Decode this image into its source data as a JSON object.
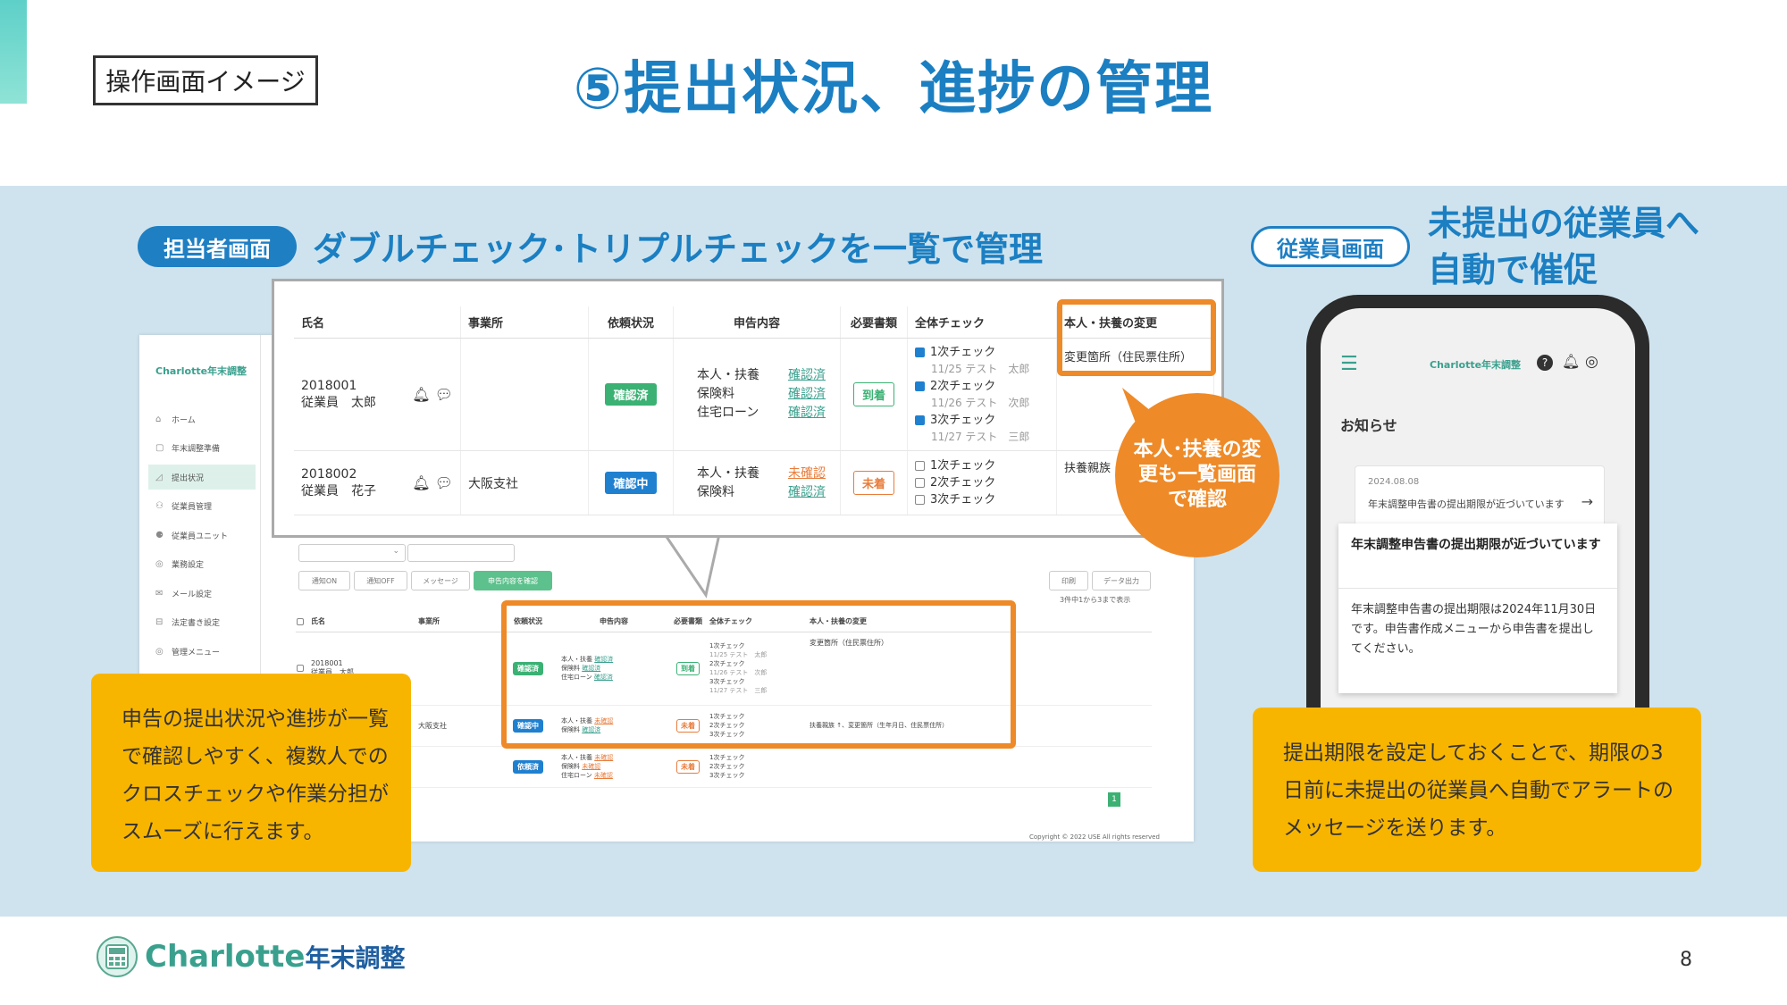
{
  "slide": {
    "op_label": "操作画面イメージ",
    "title": "⑤提出状況、進捗の管理",
    "page_number": "8"
  },
  "staff_section": {
    "pill": "担当者画面",
    "heading": "ダブルチェック･トリプルチェックを一覧で管理"
  },
  "employee_section": {
    "pill": "従業員画面",
    "heading_line1": "未提出の従業員へ",
    "heading_line2": "自動で催促"
  },
  "admin_app": {
    "logo": "Charlotte年末調整",
    "sidebar": [
      {
        "icon": "home-icon",
        "glyph": "⌂",
        "label": "ホーム"
      },
      {
        "icon": "prep-icon",
        "glyph": "▢",
        "label": "年末調整準備"
      },
      {
        "icon": "status-icon",
        "glyph": "◿",
        "label": "提出状況",
        "active": true
      },
      {
        "icon": "users-icon",
        "glyph": "⚇",
        "label": "従業員管理"
      },
      {
        "icon": "unit-icon",
        "glyph": "⚈",
        "label": "従業員ユニット"
      },
      {
        "icon": "office-icon",
        "glyph": "◎",
        "label": "業務設定"
      },
      {
        "icon": "mail-icon",
        "glyph": "✉",
        "label": "メール設定"
      },
      {
        "icon": "paper-icon",
        "glyph": "⊟",
        "label": "法定書き設定"
      },
      {
        "icon": "admin-icon",
        "glyph": "◎",
        "label": "管理メニュー"
      }
    ],
    "toolbar": {
      "notify_on": "通知ON",
      "notify_off": "通知OFF",
      "message": "メッセージ",
      "confirm": "申告内容を確認",
      "print": "印刷",
      "export": "データ出力",
      "count": "3件中1から3まで表示"
    },
    "copyright": "Copyright © 2022 USE All rights reserved"
  },
  "zoom_table": {
    "headers": [
      "氏名",
      "事業所",
      "依頼状況",
      "申告内容",
      "必要書類",
      "全体チェック",
      "本人・扶養の変更"
    ],
    "rows": [
      {
        "id": "2018001",
        "name": "従業員　太郎",
        "office": "",
        "status": "確認済",
        "items": [
          "本人・扶養",
          "保険料",
          "住宅ローン"
        ],
        "item_status": [
          "確認済",
          "確認済",
          "確認済"
        ],
        "docs": "到着",
        "checks": [
          {
            "label": "1次チェック",
            "checked": true,
            "note": "11/25 テスト　太郎"
          },
          {
            "label": "2次チェック",
            "checked": true,
            "note": "11/26 テスト　次郎"
          },
          {
            "label": "3次チェック",
            "checked": true,
            "note": "11/27 テスト　三郎"
          }
        ],
        "change": "変更箇所（住民票住所）"
      },
      {
        "id": "2018002",
        "name": "従業員　花子",
        "office": "大阪支社",
        "status": "確認中",
        "items": [
          "本人・扶養",
          "保険料"
        ],
        "item_status": [
          "未確認",
          "確認済"
        ],
        "docs": "未着",
        "checks": [
          {
            "label": "1次チェック",
            "checked": false,
            "note": ""
          },
          {
            "label": "2次チェック",
            "checked": false,
            "note": ""
          },
          {
            "label": "3次チェック",
            "checked": false,
            "note": ""
          }
        ],
        "change": "扶養親族"
      }
    ]
  },
  "small_table": {
    "headers": [
      "氏名",
      "事業所",
      "依頼状況",
      "申告内容",
      "必要書類",
      "全体チェック",
      "本人・扶養の変更"
    ],
    "rows": [
      {
        "id": "2018001",
        "name": "従業員　太郎",
        "office": "",
        "status": "確認済",
        "docs": "到着",
        "items": [
          "本人・扶養",
          "保険料",
          "住宅ローン"
        ],
        "item_status": [
          "確認済",
          "確認済",
          "確認済"
        ],
        "checks": [
          "1次チェック",
          "11/25 テスト　太郎",
          "2次チェック",
          "11/26 テスト　次郎",
          "3次チェック",
          "11/27 テスト　三郎"
        ],
        "change": "変更箇所（住民票住所）"
      },
      {
        "id": "",
        "name": "",
        "office": "大阪支社",
        "status": "確認中",
        "docs": "未着",
        "items": [
          "本人・扶養",
          "保険料"
        ],
        "item_status": [
          "未確認",
          "確認済"
        ],
        "checks": [
          "1次チェック",
          "2次チェック",
          "3次チェック"
        ],
        "change": "扶養親族 ↑、変更箇所（生年月日、住民票住所）"
      },
      {
        "id": "",
        "name": "",
        "office": "",
        "status": "依頼済",
        "docs": "未着",
        "items": [
          "本人・扶養",
          "保険料",
          "住宅ローン"
        ],
        "item_status": [
          "未確認",
          "未確認",
          "未確認"
        ],
        "checks": [
          "1次チェック",
          "2次チェック",
          "3次チェック"
        ],
        "change": ""
      }
    ],
    "page": "1"
  },
  "callout_circle": "本人･扶養の変更も一覧画面で確認",
  "note_left": "申告の提出状況や進捗が一覧で確認しやすく、複数人でのクロスチェックや作業分担がスムーズに行えます。",
  "phone": {
    "logo": "Charlotte年末調整",
    "section": "お知らせ",
    "bg_notice_date": "2024.08.08",
    "bg_notice_text": "年末調整申告書の提出期限が近づいています",
    "popup_title": "年末調整申告書の提出期限が近づいています",
    "popup_body": "年末調整申告書の提出期限は2024年11月30日です。申告書作成メニューから申告書を提出してください。"
  },
  "note_right": "提出期限を設定しておくことで、期限の3日前に未提出の従業員へ自動でアラートのメッセージを送ります。",
  "footer": {
    "brand": "Charlotte",
    "brand_suffix": "年末調整"
  },
  "colors": {
    "title_blue": "#1b7fc2",
    "band": "#cfe3ee",
    "orange": "#ee8a28",
    "yellow": "#f8b500",
    "green": "#3bb174"
  }
}
